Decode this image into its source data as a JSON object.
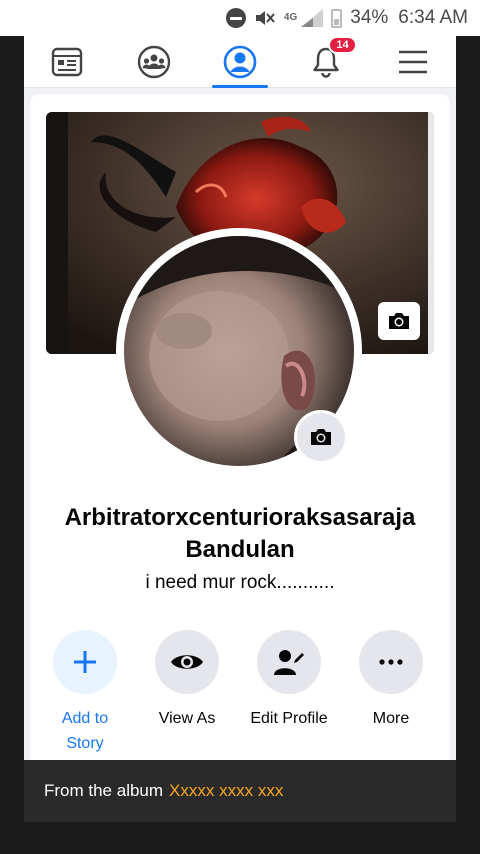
{
  "status_bar": {
    "network": "4G",
    "battery": "34%",
    "time": "6:34 AM"
  },
  "nav": {
    "items": [
      {
        "name": "feed",
        "icon": "news-feed-icon"
      },
      {
        "name": "groups",
        "icon": "groups-icon"
      },
      {
        "name": "profile",
        "icon": "profile-icon",
        "active": true
      },
      {
        "name": "notifications",
        "icon": "bell-icon",
        "badge": "14"
      },
      {
        "name": "menu",
        "icon": "hamburger-menu-icon"
      }
    ]
  },
  "profile": {
    "name": "Arbitratorxcenturioraksasaraja Bandulan",
    "name_line1": "Arbitratorxcenturioraksasaraja",
    "name_line2": "Bandulan",
    "bio": "i need mur rock..........."
  },
  "actions": [
    {
      "label_line1": "Add to",
      "label_line2": "Story",
      "icon": "plus-icon"
    },
    {
      "label": "View As",
      "icon": "eye-icon"
    },
    {
      "label": "Edit Profile",
      "icon": "edit-profile-icon"
    },
    {
      "label": "More",
      "icon": "more-dots-icon"
    }
  ],
  "caption": {
    "prefix": "From the album",
    "album": "Xxxxx xxxx xxx"
  },
  "colors": {
    "accent": "#1877f2",
    "badge": "#e41e3f",
    "album_link": "#f5a623"
  }
}
